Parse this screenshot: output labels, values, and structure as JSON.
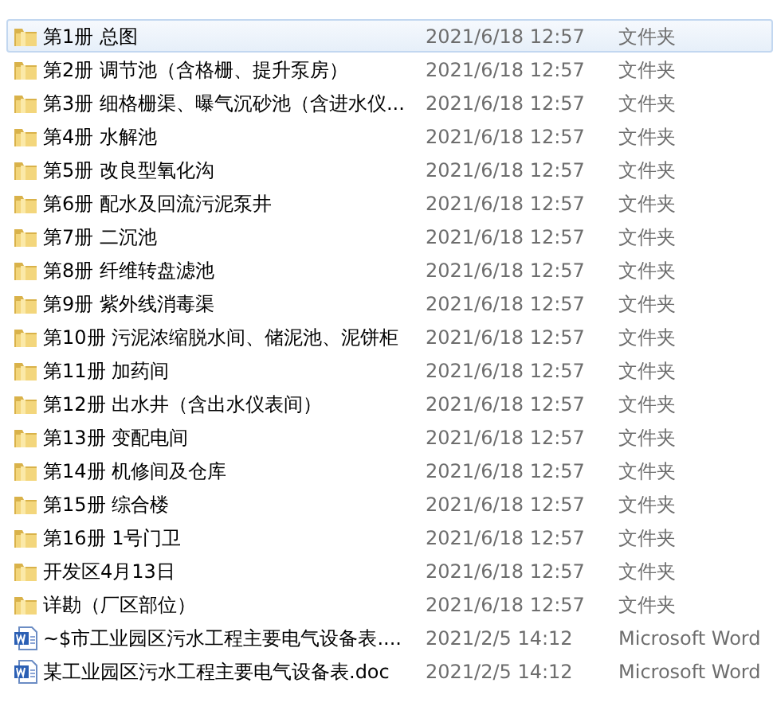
{
  "files": [
    {
      "kind": "folder",
      "name": "第1册 总图",
      "date": "2021/6/18 12:57",
      "type": "文件夹",
      "selected": true
    },
    {
      "kind": "folder",
      "name": "第2册 调节池（含格栅、提升泵房）",
      "date": "2021/6/18 12:57",
      "type": "文件夹",
      "selected": false
    },
    {
      "kind": "folder",
      "name": "第3册 细格栅渠、曝气沉砂池（含进水仪...",
      "date": "2021/6/18 12:57",
      "type": "文件夹",
      "selected": false
    },
    {
      "kind": "folder",
      "name": "第4册 水解池",
      "date": "2021/6/18 12:57",
      "type": "文件夹",
      "selected": false
    },
    {
      "kind": "folder",
      "name": "第5册 改良型氧化沟",
      "date": "2021/6/18 12:57",
      "type": "文件夹",
      "selected": false
    },
    {
      "kind": "folder",
      "name": "第6册 配水及回流污泥泵井",
      "date": "2021/6/18 12:57",
      "type": "文件夹",
      "selected": false
    },
    {
      "kind": "folder",
      "name": "第7册 二沉池",
      "date": "2021/6/18 12:57",
      "type": "文件夹",
      "selected": false
    },
    {
      "kind": "folder",
      "name": "第8册 纤维转盘滤池",
      "date": "2021/6/18 12:57",
      "type": "文件夹",
      "selected": false
    },
    {
      "kind": "folder",
      "name": "第9册 紫外线消毒渠",
      "date": "2021/6/18 12:57",
      "type": "文件夹",
      "selected": false
    },
    {
      "kind": "folder",
      "name": "第10册  污泥浓缩脱水间、储泥池、泥饼柜",
      "date": "2021/6/18 12:57",
      "type": "文件夹",
      "selected": false
    },
    {
      "kind": "folder",
      "name": "第11册 加药间",
      "date": "2021/6/18 12:57",
      "type": "文件夹",
      "selected": false
    },
    {
      "kind": "folder",
      "name": "第12册 出水井（含出水仪表间）",
      "date": "2021/6/18 12:57",
      "type": "文件夹",
      "selected": false
    },
    {
      "kind": "folder",
      "name": "第13册 变配电间",
      "date": "2021/6/18 12:57",
      "type": "文件夹",
      "selected": false
    },
    {
      "kind": "folder",
      "name": "第14册 机修间及仓库",
      "date": "2021/6/18 12:57",
      "type": "文件夹",
      "selected": false
    },
    {
      "kind": "folder",
      "name": "第15册 综合楼",
      "date": "2021/6/18 12:57",
      "type": "文件夹",
      "selected": false
    },
    {
      "kind": "folder",
      "name": "第16册 1号门卫",
      "date": "2021/6/18 12:57",
      "type": "文件夹",
      "selected": false
    },
    {
      "kind": "folder",
      "name": "开发区4月13日",
      "date": "2021/6/18 12:57",
      "type": "文件夹",
      "selected": false
    },
    {
      "kind": "folder",
      "name": "详勘（厂区部位）",
      "date": "2021/6/18 12:57",
      "type": "文件夹",
      "selected": false
    },
    {
      "kind": "word",
      "name": "~$市工业园区污水工程主要电气设备表....",
      "date": "2021/2/5 14:12",
      "type": "Microsoft Word",
      "selected": false
    },
    {
      "kind": "word",
      "name": "某工业园区污水工程主要电气设备表.doc",
      "date": "2021/2/5 14:12",
      "type": "Microsoft Word",
      "selected": false
    }
  ]
}
